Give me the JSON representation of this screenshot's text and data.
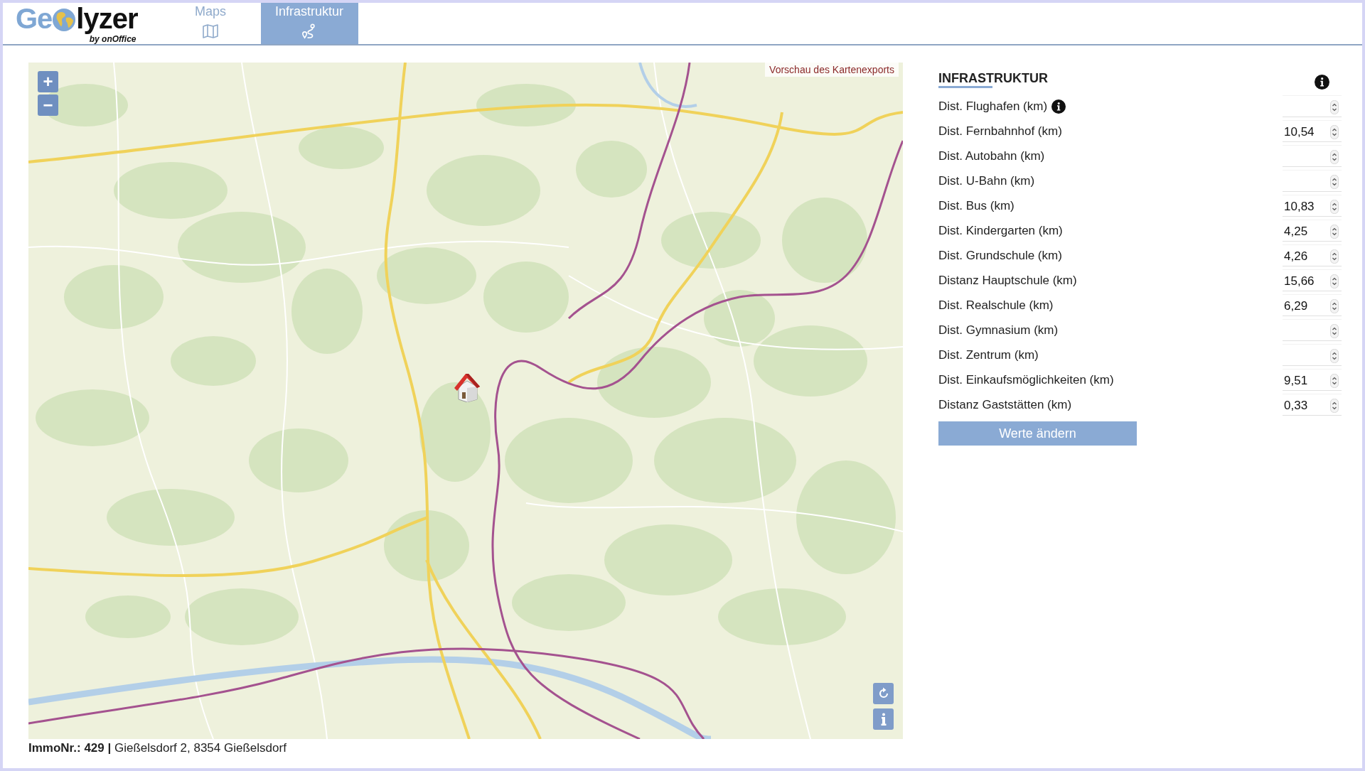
{
  "header": {
    "logo": {
      "prefix": "Ge",
      "suffix": "lyzer",
      "tagline": "by onOffice"
    },
    "tabs": [
      {
        "label": "Maps",
        "kind": "map",
        "selected": false
      },
      {
        "label": "Infrastruktur",
        "kind": "route",
        "selected": true
      }
    ]
  },
  "map": {
    "zoom_buttons": [
      "+",
      "−"
    ],
    "export_preview_label": "Vorschau des Kartenexports",
    "property_caption": "**ImmoNr.: 429 |** Gießelsdorf 2, 8354 Gießelsdorf"
  },
  "infrastructure_panel": {
    "title": "INFRASTRUKTUR",
    "fields": [
      {
        "label": "Dist. Flughafen (km)",
        "info": true
      },
      {
        "label": "Dist. Fernbahnhof (km)",
        "value": "10,54",
        "info": false
      },
      {
        "label": "Dist. Autobahn (km)",
        "info": false
      },
      {
        "label": "Dist. U-Bahn (km)",
        "info": false
      },
      {
        "label": "Dist. Bus (km)",
        "value": "10,83",
        "info": false
      },
      {
        "label": "Dist. Kindergarten (km)",
        "value": "4,25",
        "info": false
      },
      {
        "label": "Dist. Grundschule (km)",
        "value": "4,26",
        "info": false
      },
      {
        "label": "Distanz Hauptschule (km)",
        "value": "15,66",
        "info": false
      },
      {
        "label": "Dist. Realschule (km)",
        "value": "6,29",
        "info": false
      },
      {
        "label": "Dist. Gymnasium (km)",
        "info": false
      },
      {
        "label": "Dist. Zentrum (km)",
        "info": false
      },
      {
        "label": "Dist. Einkaufsmöglichkeiten (km)",
        "value": "9,51",
        "info": false
      },
      {
        "label": "Distanz Gaststätten (km)",
        "value": "0,33",
        "info": false
      }
    ],
    "submit_button": "Werte ändern"
  }
}
